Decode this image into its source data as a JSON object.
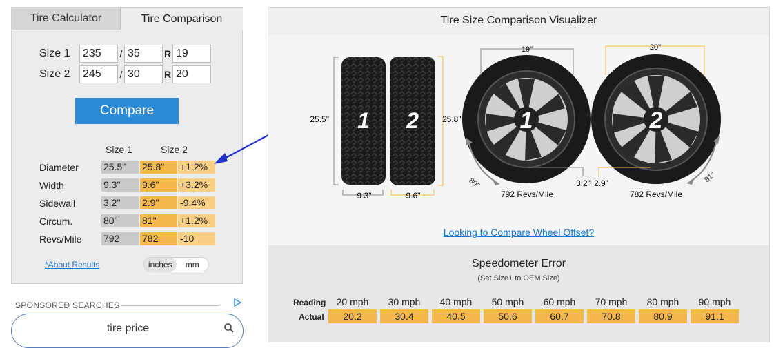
{
  "tabs": {
    "calculator": "Tire Calculator",
    "comparison": "Tire Comparison"
  },
  "size1": {
    "label": "Size 1",
    "width": "235",
    "aspect": "35",
    "sep": "/",
    "r": "R",
    "rim": "19"
  },
  "size2": {
    "label": "Size 2",
    "width": "245",
    "aspect": "30",
    "sep": "/",
    "r": "R",
    "rim": "20"
  },
  "compare_label": "Compare",
  "results": {
    "col1": "Size 1",
    "col2": "Size 2",
    "rows": [
      {
        "label": "Diameter",
        "s1": "25.5\"",
        "s2": "25.8\"",
        "diff": "+1.2%"
      },
      {
        "label": "Width",
        "s1": "9.3\"",
        "s2": "9.6\"",
        "diff": "+3.2%"
      },
      {
        "label": "Sidewall",
        "s1": "3.2\"",
        "s2": "2.9\"",
        "diff": "-9.4%"
      },
      {
        "label": "Circum.",
        "s1": "80\"",
        "s2": "81\"",
        "diff": "+1.2%"
      },
      {
        "label": "Revs/Mile",
        "s1": "792",
        "s2": "782",
        "diff": "-10"
      }
    ]
  },
  "about_link": "*About Results",
  "units": {
    "inches": "inches",
    "mm": "mm",
    "selected": "inches"
  },
  "sponsored": {
    "label": "SPONSORED SEARCHES",
    "search_text": "tire price"
  },
  "visualizer": {
    "title": "Tire Size Comparison Visualizer",
    "tire1_num": "1",
    "tire2_num": "2",
    "height1": "25.5\"",
    "height2": "25.8\"",
    "width1": "9.3\"",
    "width2": "9.6\"",
    "wheel1_rim": "19\"",
    "wheel2_rim": "20\"",
    "wheel1_sidewall": "3.2\"",
    "wheel2_sidewall": "2.9\"",
    "wheel1_circ": "80\"",
    "wheel2_circ": "81\"",
    "wheel1_revs": "792 Revs/Mile",
    "wheel2_revs": "782 Revs/Mile",
    "offset_link": "Looking to Compare Wheel Offset?"
  },
  "speedometer": {
    "title": "Speedometer Error",
    "subtitle": "(Set Size1 to OEM Size)",
    "reading_label": "Reading",
    "actual_label": "Actual",
    "readings": [
      "20 mph",
      "30 mph",
      "40 mph",
      "50 mph",
      "60 mph",
      "70 mph",
      "80 mph",
      "90 mph"
    ],
    "actuals": [
      "20.2",
      "30.4",
      "40.5",
      "50.6",
      "60.7",
      "70.8",
      "80.9",
      "91.1"
    ]
  },
  "colors": {
    "accent": "#2d8ad6",
    "size2": "#f4b84d",
    "diff": "#f9ce85",
    "size1": "#c9c9c9",
    "arrow": "#1f2fc8"
  }
}
